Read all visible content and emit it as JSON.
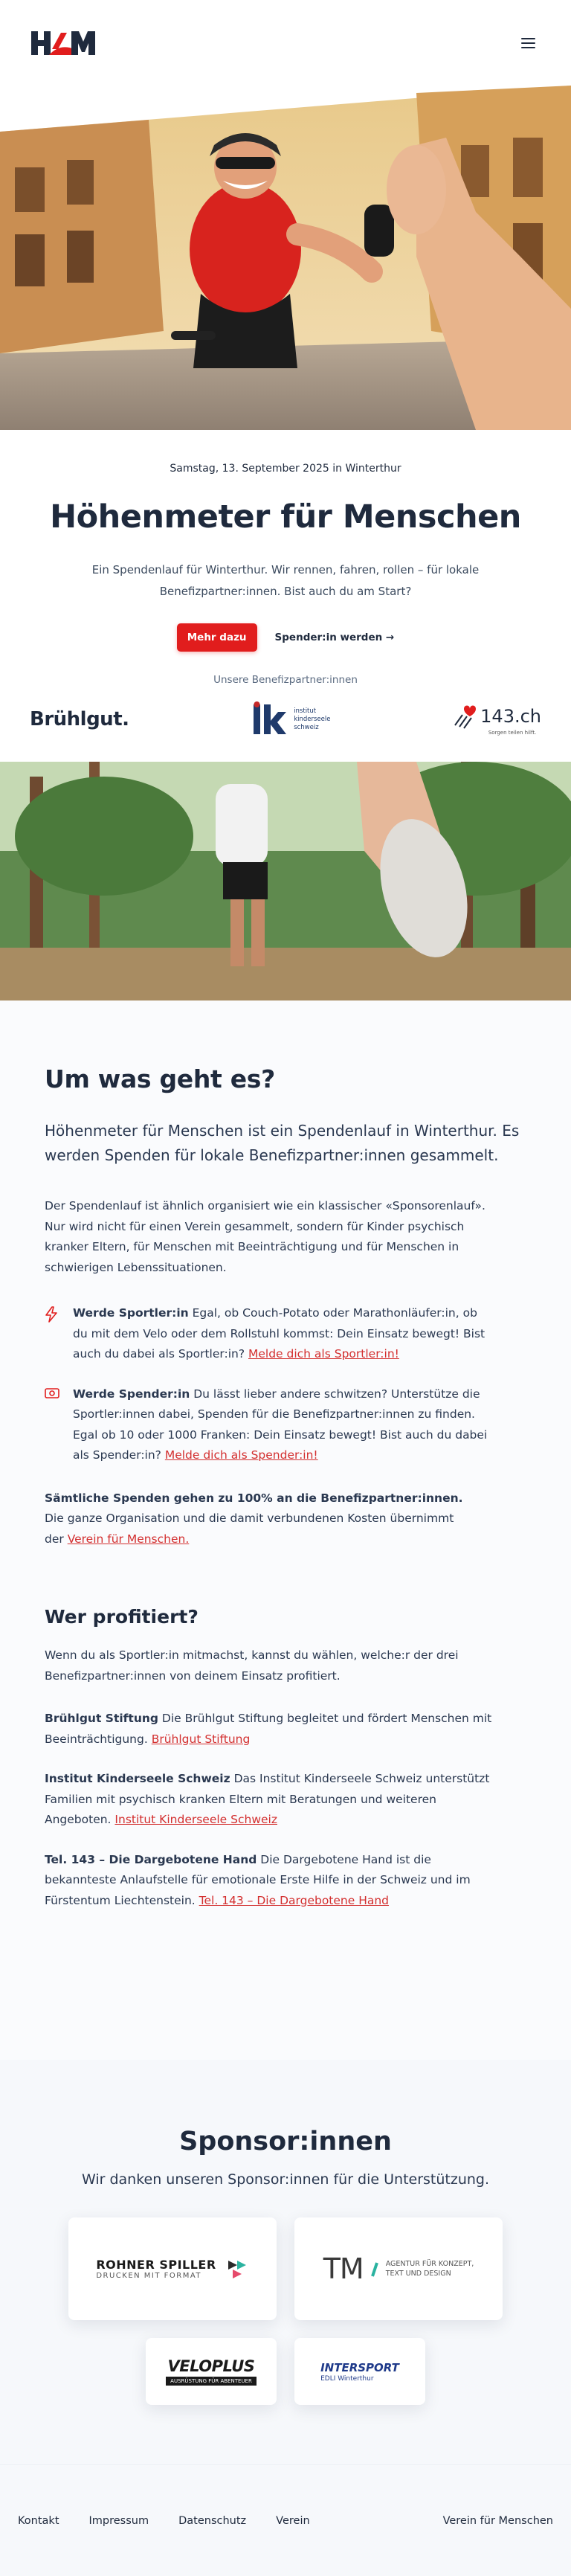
{
  "header": {
    "logo_text": "KM",
    "menu_icon": "hamburger-menu-icon"
  },
  "hero": {
    "date": "Samstag, 13. September 2025 in Winterthur",
    "title": "Höhenmeter für Menschen",
    "subtitle": "Ein Spendenlauf für Winterthur. Wir rennen, fahren, rollen – für lokale Benefizpartner:innen. Bist auch du am Start?",
    "primary_cta": "Mehr dazu",
    "secondary_cta": "Spender:in werden →",
    "partners_label": "Unsere Benefizpartner:innen",
    "partners": [
      {
        "name": "Brühlgut."
      },
      {
        "name": "ks",
        "caption_lines": [
          "institut",
          "kinderseele",
          "schweiz"
        ]
      },
      {
        "name": "143.ch",
        "caption": "Sorgen teilen hilft."
      }
    ]
  },
  "about": {
    "title": "Um was geht es?",
    "lead": "Höhenmeter für Menschen ist ein Spendenlauf in Winterthur. Es werden Spenden für lokale Benefizpartner:innen gesammelt.",
    "intro": "Der Spendenlauf ist ähnlich organisiert wie ein klassischer «Sponsorenlauf». Nur wird nicht für einen Verein gesammelt, sondern für Kinder psychisch kranker Eltern, für Menschen mit Beeinträchtigung und für Menschen in schwierigen Lebenssituationen.",
    "features": [
      {
        "icon": "lightning-icon",
        "bold": "Werde Sportler:in",
        "text": " Egal, ob Couch-Potato oder Marathonläufer:in, ob du mit dem Velo oder dem Rollstuhl kommst: Dein Einsatz bewegt! Bist auch du dabei als Sportler:in? ",
        "link": "Melde dich als Sportler:in!"
      },
      {
        "icon": "money-icon",
        "bold": "Werde Spender:in",
        "text": " Du lässt lieber andere schwitzen? Unterstütze die Sportler:innen dabei, Spenden für die Benefizpartner:innen zu finden. Egal ob 10 oder 1000 Franken: Dein Einsatz bewegt! Bist auch du dabei als Spender:in? ",
        "link": "Melde dich als Spender:in!"
      }
    ],
    "note_bold": "Sämtliche Spenden gehen zu 100% an die Benefizpartner:innen.",
    "note_text": " Die ganze Organisation und die damit verbundenen Kosten übernimmt der ",
    "note_link": "Verein für Menschen."
  },
  "profit": {
    "title": "Wer profitiert?",
    "intro": "Wenn du als Sportler:in mitmachst, kannst du wählen, welche:r der drei Benefizpartner:innen von deinem Einsatz profitiert.",
    "items": [
      {
        "bold": "Brühlgut Stiftung",
        "text": " Die Brühlgut Stiftung begleitet und fördert Menschen mit Beeinträchtigung. ",
        "link": "Brühlgut Stiftung"
      },
      {
        "bold": "Institut Kinderseele Schweiz",
        "text": " Das Institut Kinderseele Schweiz unterstützt Familien mit psychisch kranken Eltern mit Beratungen und weiteren Angeboten. ",
        "link": "Institut Kinderseele Schweiz"
      },
      {
        "bold": "Tel. 143 – Die Dargebotene Hand",
        "text": " Die Dargebotene Hand ist die bekannteste Anlaufstelle für emotionale Erste Hilfe in der Schweiz und im Fürstentum Liechtenstein. ",
        "link": "Tel. 143 – Die Dargebotene Hand"
      }
    ]
  },
  "sponsors": {
    "title": "Sponsor:innen",
    "subtitle": "Wir danken unseren Sponsor:innen für die Unterstützung.",
    "list": [
      {
        "name": "ROHNER SPILLER",
        "tagline": "DRUCKEN MIT FORMAT"
      },
      {
        "name": "TM",
        "tagline_lines": [
          "AGENTUR FÜR KONZEPT,",
          "TEXT UND DESIGN"
        ]
      },
      {
        "name": "VELOPLUS",
        "tagline": "AUSRÜSTUNG FÜR ABENTEUER"
      },
      {
        "name": "INTERSPORT",
        "tagline": "EDLI Winterthur"
      }
    ]
  },
  "footer": {
    "links": [
      "Kontakt",
      "Impressum",
      "Datenschutz",
      "Verein"
    ],
    "right": "Verein für Menschen"
  },
  "colors": {
    "accent": "#e11d1d",
    "navy": "#1f2a3d",
    "link": "#d32f2f"
  }
}
